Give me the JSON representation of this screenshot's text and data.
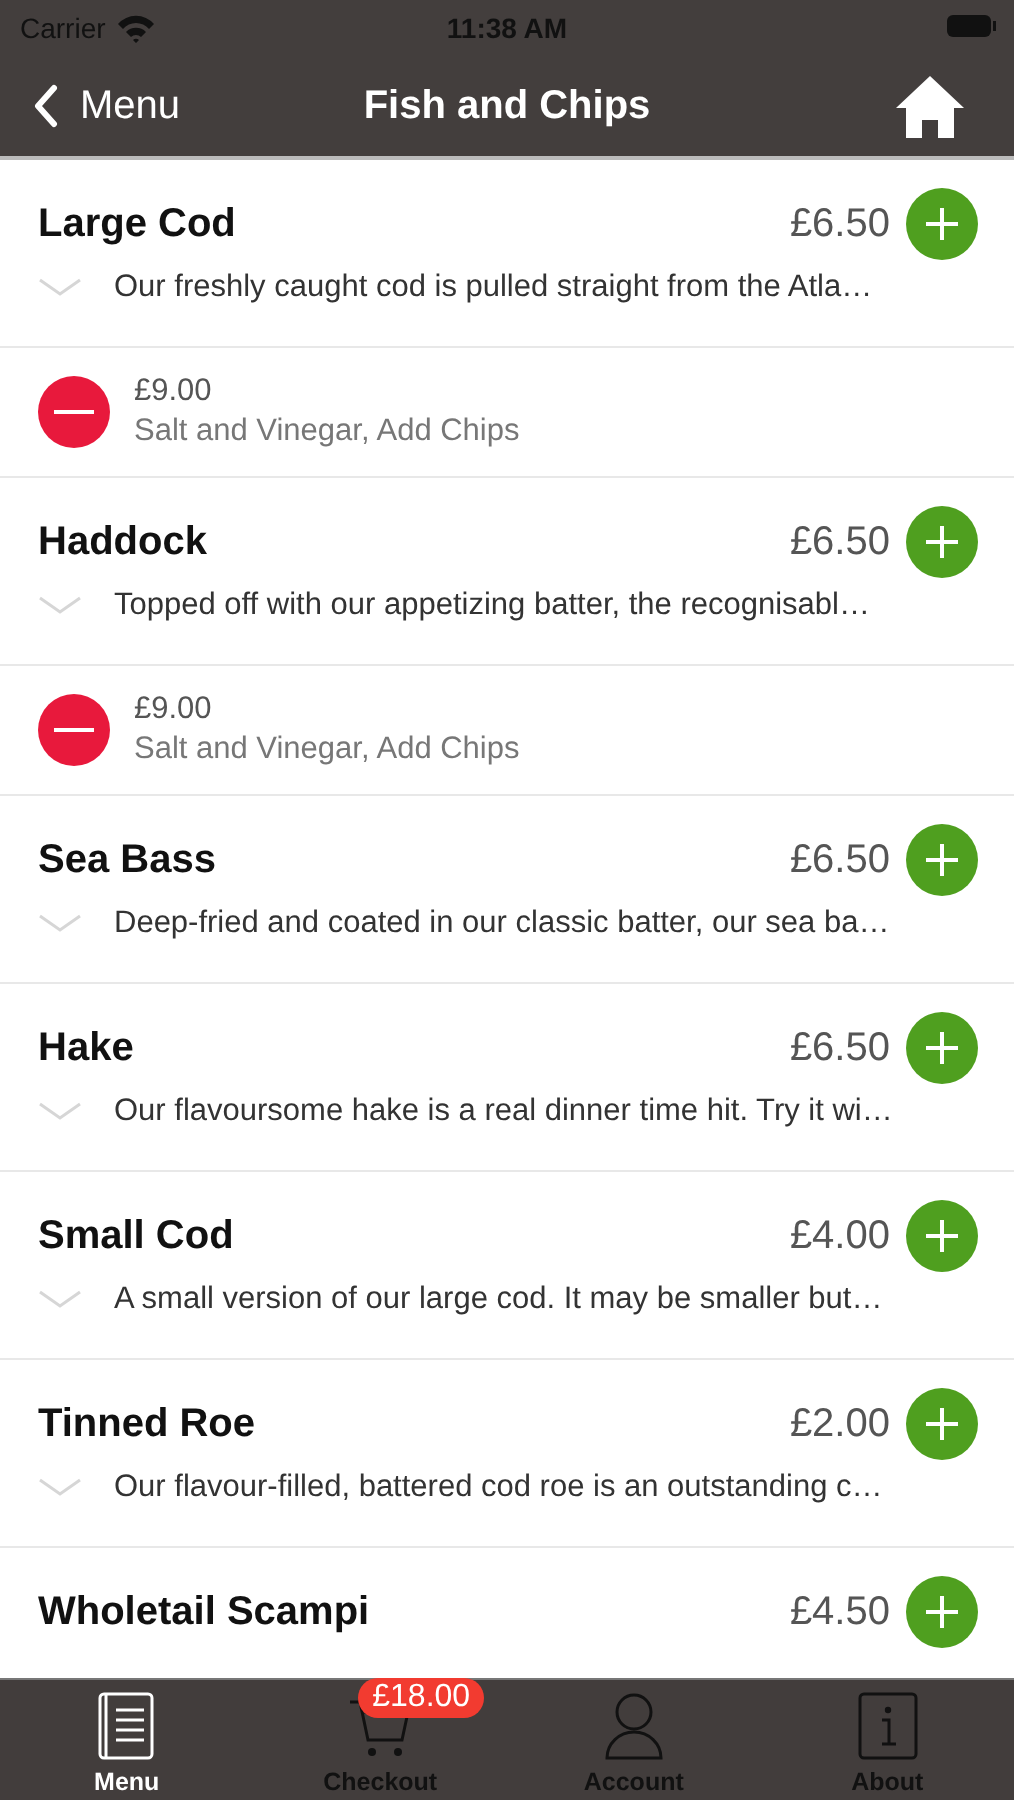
{
  "status_bar": {
    "carrier": "Carrier",
    "time": "11:38 AM"
  },
  "nav": {
    "back": "Menu",
    "title": "Fish and Chips"
  },
  "list": [
    {
      "kind": "product",
      "name": "Large Cod",
      "price": "£6.50",
      "description": "Our freshly caught cod is pulled straight from the Atla…"
    },
    {
      "kind": "added",
      "price": "£9.00",
      "options": "Salt and Vinegar, Add Chips"
    },
    {
      "kind": "product",
      "name": "Haddock",
      "price": "£6.50",
      "description": "Topped off with our appetizing batter, the recognisabl…"
    },
    {
      "kind": "added",
      "price": "£9.00",
      "options": "Salt and Vinegar, Add Chips"
    },
    {
      "kind": "product",
      "name": "Sea Bass",
      "price": "£6.50",
      "description": "Deep-fried and coated in our classic batter, our sea ba…"
    },
    {
      "kind": "product",
      "name": "Hake",
      "price": "£6.50",
      "description": "Our flavoursome hake is a real dinner time hit. Try it wi…"
    },
    {
      "kind": "product",
      "name": "Small Cod",
      "price": "£4.00",
      "description": "A small version of our large cod. It may be smaller but…"
    },
    {
      "kind": "product",
      "name": "Tinned Roe",
      "price": "£2.00",
      "description": "Our flavour-filled, battered cod roe is an outstanding c…"
    },
    {
      "kind": "product",
      "name": "Wholetail Scampi",
      "price": "£4.50"
    }
  ],
  "tabs": [
    {
      "label": "Menu",
      "selected": true
    },
    {
      "label": "Checkout",
      "selected": false,
      "badge": "£18.00"
    },
    {
      "label": "Account",
      "selected": false
    },
    {
      "label": "About",
      "selected": false
    }
  ]
}
